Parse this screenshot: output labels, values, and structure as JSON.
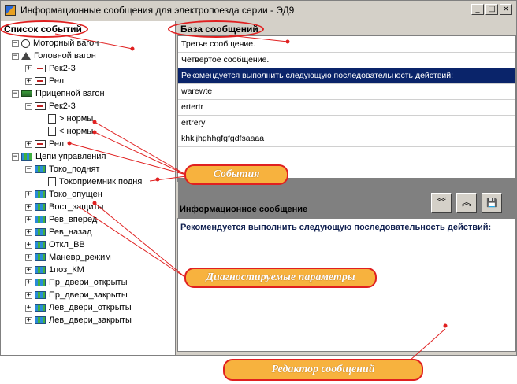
{
  "window": {
    "title": "Информационные сообщения для электропоезда серии - ЭД9"
  },
  "left": {
    "header": "Список событий",
    "tree": [
      {
        "label": "Моторный вагон",
        "icon": "motor-car-icon",
        "indent": 0,
        "expander": "−"
      },
      {
        "label": "Головной вагон",
        "icon": "head-car-icon",
        "indent": 0,
        "expander": "−"
      },
      {
        "label": "Рек2-3",
        "icon": "module-icon",
        "indent": 1,
        "expander": "+"
      },
      {
        "label": "Рел",
        "icon": "module-icon",
        "indent": 1,
        "expander": "+"
      },
      {
        "label": "Прицепной вагон",
        "icon": "trailer-car-icon",
        "indent": 0,
        "expander": "−"
      },
      {
        "label": "Рек2-3",
        "icon": "module-icon",
        "indent": 1,
        "expander": "−"
      },
      {
        "label": "> нормы",
        "icon": "document-icon",
        "indent": 2,
        "expander": ""
      },
      {
        "label": "< нормы",
        "icon": "document-icon",
        "indent": 2,
        "expander": ""
      },
      {
        "label": "Рел",
        "icon": "module-icon",
        "indent": 1,
        "expander": "+"
      },
      {
        "label": "Цепи управления",
        "icon": "control-chain-icon",
        "indent": 0,
        "expander": "−"
      },
      {
        "label": "Токо_поднят",
        "icon": "control-chain-icon",
        "indent": 1,
        "expander": "−"
      },
      {
        "label": "Токоприемник подня",
        "icon": "document-icon",
        "indent": 2,
        "expander": ""
      },
      {
        "label": "Токо_опущен",
        "icon": "control-chain-icon",
        "indent": 1,
        "expander": "+"
      },
      {
        "label": "Вост_защиты",
        "icon": "control-chain-icon",
        "indent": 1,
        "expander": "+"
      },
      {
        "label": "Рев_вперед",
        "icon": "control-chain-icon",
        "indent": 1,
        "expander": "+"
      },
      {
        "label": "Рев_назад",
        "icon": "control-chain-icon",
        "indent": 1,
        "expander": "+"
      },
      {
        "label": "Откл_ВВ",
        "icon": "control-chain-icon",
        "indent": 1,
        "expander": "+"
      },
      {
        "label": "Маневр_режим",
        "icon": "control-chain-icon",
        "indent": 1,
        "expander": "+"
      },
      {
        "label": "1поз_КМ",
        "icon": "control-chain-icon",
        "indent": 1,
        "expander": "+"
      },
      {
        "label": "Пр_двери_открыты",
        "icon": "control-chain-icon",
        "indent": 1,
        "expander": "+"
      },
      {
        "label": "Пр_двери_закрыты",
        "icon": "control-chain-icon",
        "indent": 1,
        "expander": "+"
      },
      {
        "label": "Лев_двери_открыты",
        "icon": "control-chain-icon",
        "indent": 1,
        "expander": "+"
      },
      {
        "label": "Лев_двери_закрыты",
        "icon": "control-chain-icon",
        "indent": 1,
        "expander": "+"
      }
    ]
  },
  "right": {
    "header": "База сообщений",
    "messages": [
      {
        "text": "Третье сообщение.",
        "selected": false
      },
      {
        "text": "Четвертое сообщение.",
        "selected": false
      },
      {
        "text": "Рекомендуется выполнить следующую последовательность действий:",
        "selected": true
      },
      {
        "text": "warewte",
        "selected": false
      },
      {
        "text": "ertertr",
        "selected": false
      },
      {
        "text": "ertrery",
        "selected": false
      },
      {
        "text": "khkjjhghhgfgfgdfsaaaa",
        "selected": false
      },
      {
        "text": "",
        "selected": false
      }
    ],
    "editor_label": "Информационное сообщение",
    "editor_text": "Рекомендуется выполнить следующую последовательность действий:",
    "buttons": {
      "down": "︾",
      "up": "︽",
      "save": "💾"
    }
  },
  "callouts": {
    "events": "События",
    "diagnostic": "Диагностируемые параметры",
    "editor": "Редактор сообщений"
  },
  "colors": {
    "selection": "#0a246a",
    "callout_fill": "#f7b23e",
    "callout_border": "#e02020"
  }
}
